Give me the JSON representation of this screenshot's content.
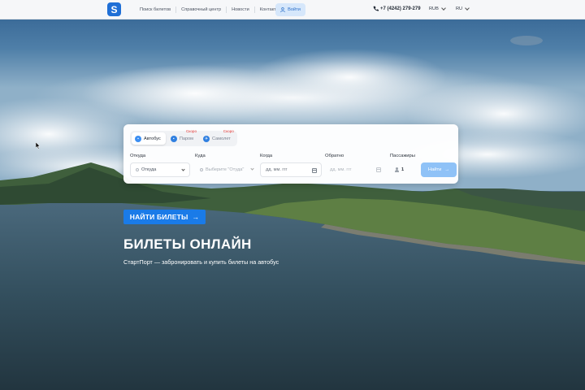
{
  "header": {
    "logo_letter": "S",
    "nav": [
      "Поиск билетов",
      "Справочный центр",
      "Новости",
      "Контакты"
    ],
    "login_label": "Войти",
    "phone": "+7 (4242) 279-279",
    "currency": "RUB",
    "language": "RU"
  },
  "search": {
    "modes": [
      {
        "label": "Автобус",
        "badge": "",
        "active": true
      },
      {
        "label": "Паром",
        "badge": "Скоро",
        "active": false
      },
      {
        "label": "Самолет",
        "badge": "Скоро",
        "active": false
      }
    ],
    "fields": {
      "from": {
        "label": "Откуда",
        "value": "Откуда"
      },
      "to": {
        "label": "Куда",
        "placeholder": "Выберите \"Отуда\""
      },
      "when": {
        "label": "Когда",
        "placeholder": "дд. мм. ггг"
      },
      "back": {
        "label": "Обратно",
        "placeholder": "дд. мм. ггг"
      },
      "passengers": {
        "label": "Пассажиры",
        "value": "1"
      }
    },
    "find_label": "Найти"
  },
  "hero": {
    "button_label": "НАЙТИ БИЛЕТЫ",
    "title": "БИЛЕТЫ ОНЛАЙН",
    "subtitle": "СтартПорт — забронировать и купить билеты на автобус"
  },
  "colors": {
    "accent": "#1a7be8",
    "logo": "#1f6fd6",
    "find_button": "#8fc2f7",
    "soon_badge": "#e53935"
  }
}
